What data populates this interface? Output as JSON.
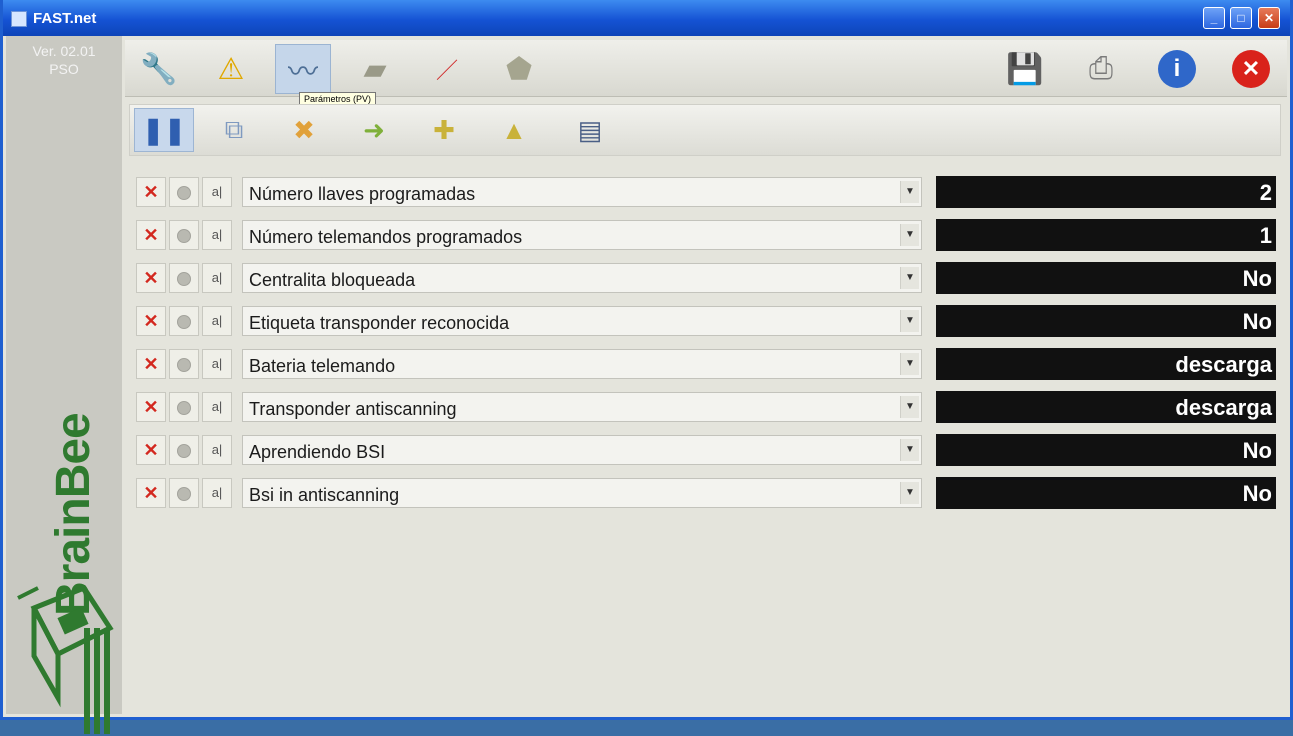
{
  "window": {
    "title": "FAST.net"
  },
  "sidebar": {
    "version_line1": "Ver. 02.01",
    "version_line2": "PSO",
    "brand": "BrainBee"
  },
  "toolbar_main": {
    "tooltip": "Parámetros (PV)",
    "buttons": [
      {
        "icon": "diagnosis-icon"
      },
      {
        "icon": "warning-icon"
      },
      {
        "icon": "parameters-icon"
      },
      {
        "icon": "activations-icon"
      },
      {
        "icon": "adjust-icon"
      },
      {
        "icon": "info-board-icon"
      },
      {
        "icon": "save-icon"
      },
      {
        "icon": "print-icon"
      },
      {
        "icon": "help-icon"
      },
      {
        "icon": "close-icon"
      }
    ]
  },
  "toolbar_sub": {
    "buttons": [
      {
        "icon": "pause-icon"
      },
      {
        "icon": "copy-icon"
      },
      {
        "icon": "folder-delete-icon"
      },
      {
        "icon": "folder-forward-icon"
      },
      {
        "icon": "folder-add-icon"
      },
      {
        "icon": "folder-up-icon"
      },
      {
        "icon": "graph-icon"
      }
    ]
  },
  "params": [
    {
      "label": "Número llaves programadas",
      "value": "2"
    },
    {
      "label": "Número telemandos programados",
      "value": "1"
    },
    {
      "label": "Centralita bloqueada",
      "value": "No"
    },
    {
      "label": "Etiqueta transponder reconocida",
      "value": "No"
    },
    {
      "label": "Bateria telemando",
      "value": "descarga"
    },
    {
      "label": "Transponder antiscanning",
      "value": "descarga"
    },
    {
      "label": "Aprendiendo BSI",
      "value": "No"
    },
    {
      "label": "Bsi in antiscanning",
      "value": "No"
    }
  ]
}
